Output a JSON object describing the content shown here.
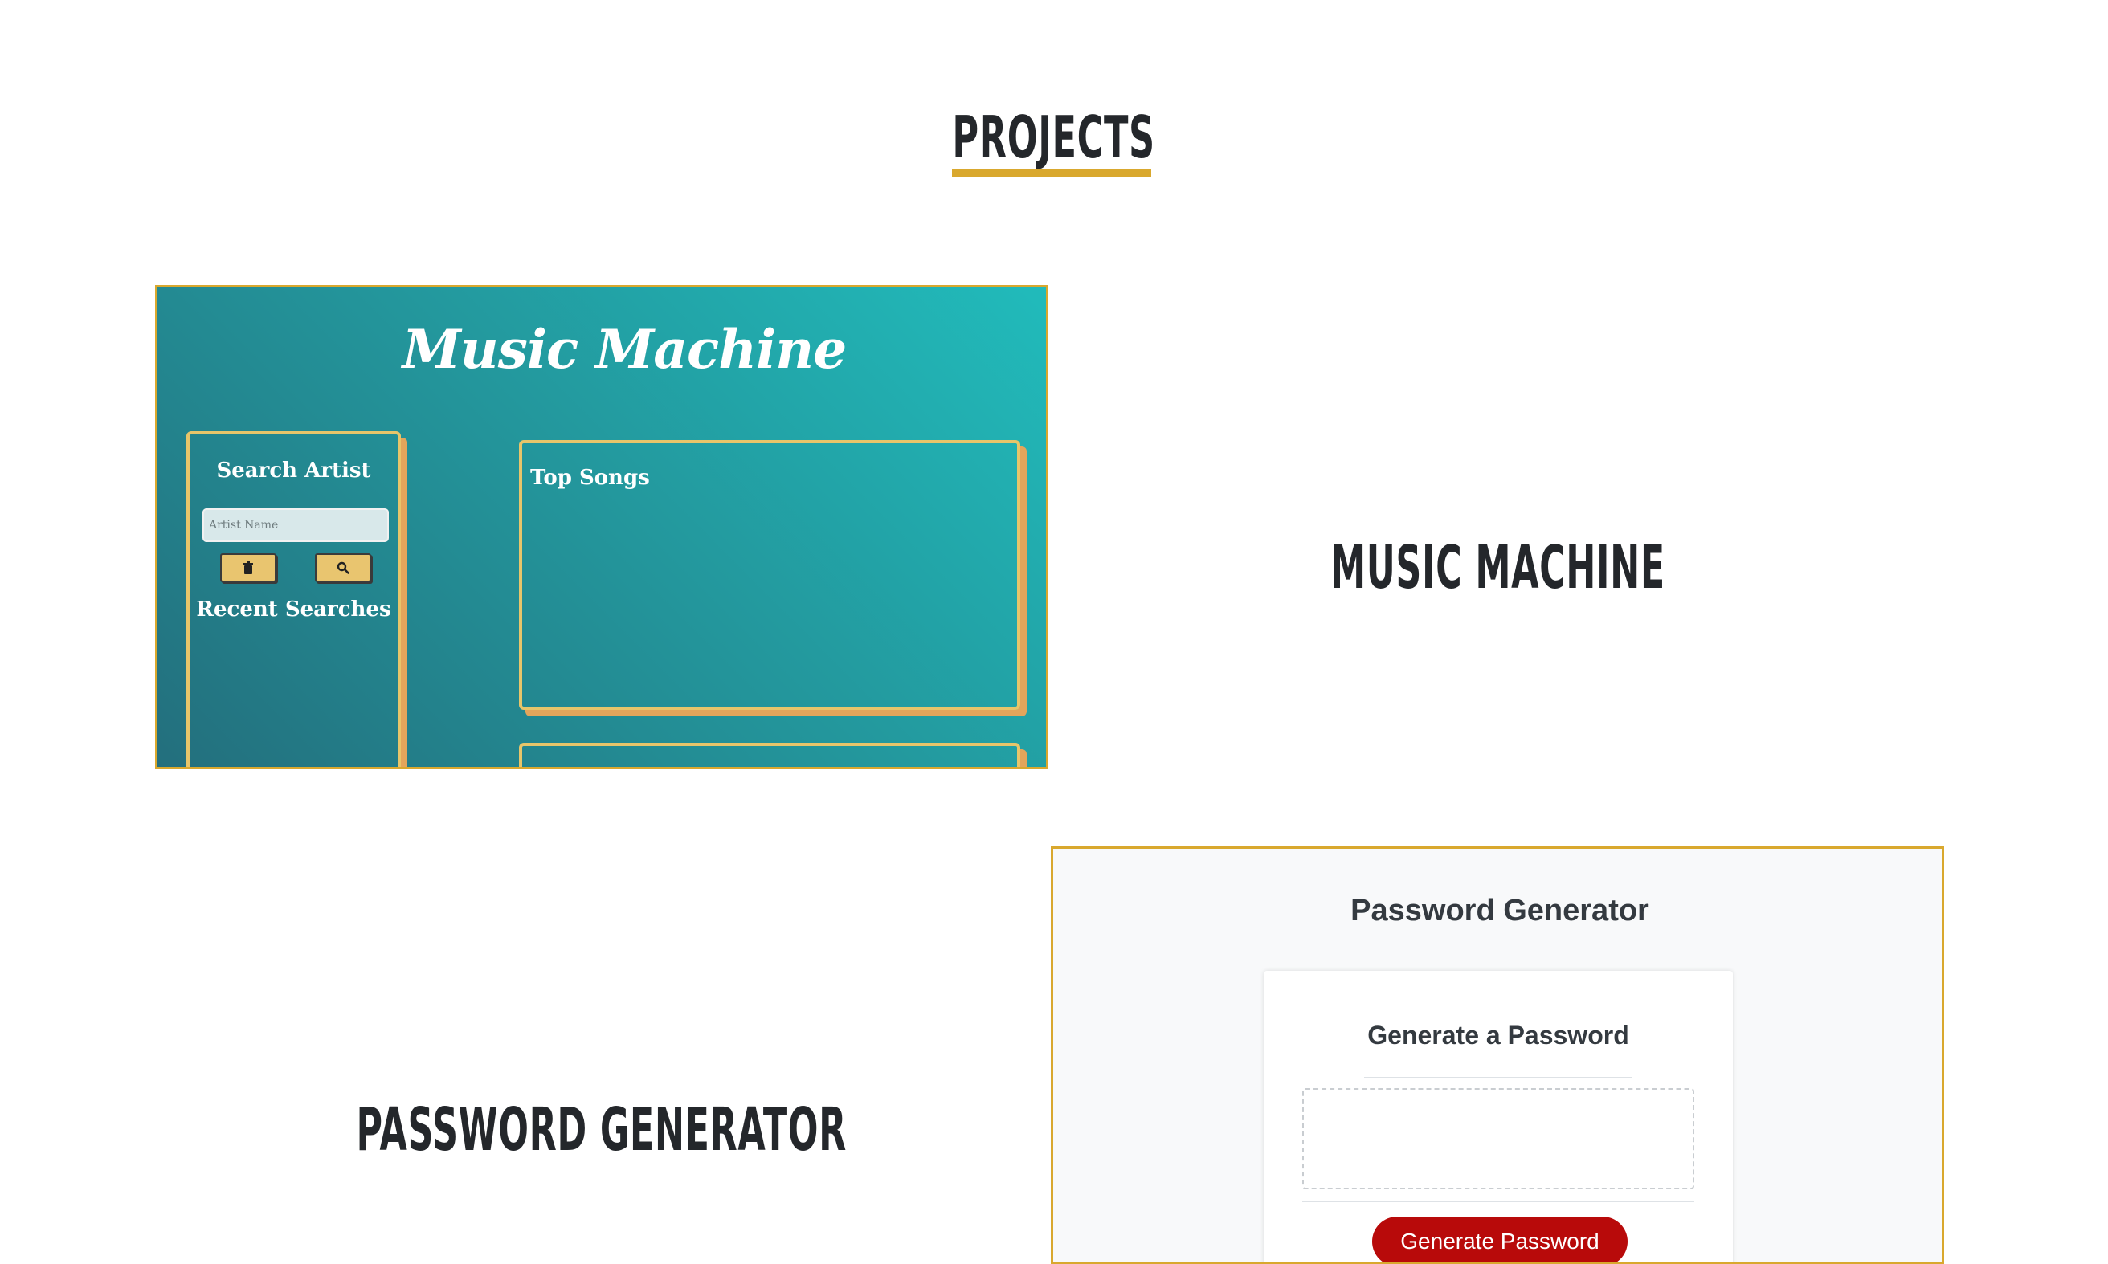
{
  "section": {
    "title": "Projects",
    "accent_color": "#d9a82e"
  },
  "projects": [
    {
      "name": "Music Machine",
      "screenshot": {
        "title": "Music Machine",
        "search_heading": "Search Artist",
        "search_placeholder": "Artist Name",
        "clear_icon": "trash-icon",
        "search_icon": "search-icon",
        "recent_heading": "Recent Searches",
        "top_songs_heading": "Top Songs"
      }
    },
    {
      "name": "Password Generator",
      "screenshot": {
        "title": "Password Generator",
        "card_title": "Generate a Password",
        "password_value": "",
        "button_label": "Generate Password",
        "button_color": "#b80a0a"
      }
    }
  ]
}
